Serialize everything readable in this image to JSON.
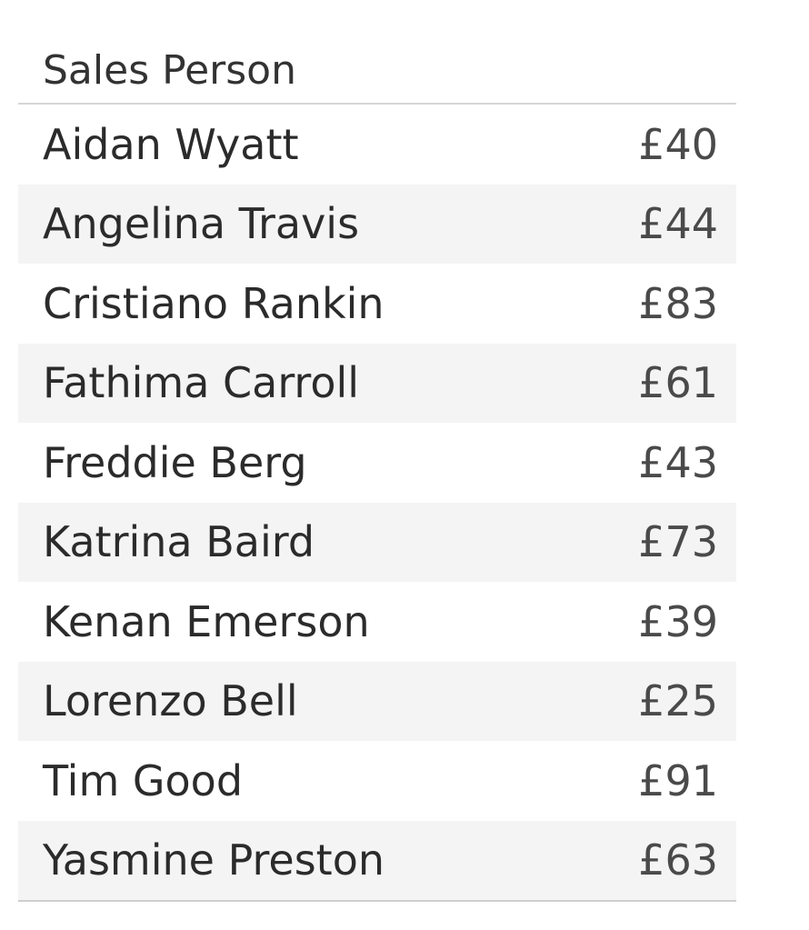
{
  "chart_data": {
    "type": "table",
    "header": "Sales Person",
    "rows": [
      {
        "name": "Aidan Wyatt",
        "value": "£40"
      },
      {
        "name": "Angelina Travis",
        "value": "£44"
      },
      {
        "name": "Cristiano Rankin",
        "value": "£83"
      },
      {
        "name": "Fathima Carroll",
        "value": "£61"
      },
      {
        "name": "Freddie Berg",
        "value": "£43"
      },
      {
        "name": "Katrina Baird",
        "value": "£73"
      },
      {
        "name": "Kenan Emerson",
        "value": "£39"
      },
      {
        "name": "Lorenzo Bell",
        "value": "£25"
      },
      {
        "name": "Tim Good",
        "value": "£91"
      },
      {
        "name": "Yasmine Preston",
        "value": "£63"
      }
    ]
  },
  "colors": {
    "alt_row": "#f4f4f4",
    "rule": "#d6d6d6"
  }
}
